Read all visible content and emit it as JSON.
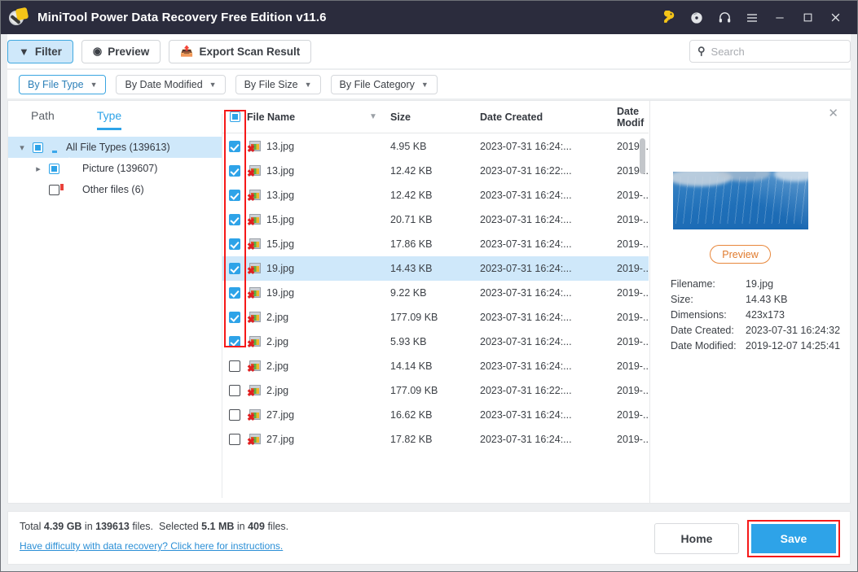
{
  "window": {
    "title": "MiniTool Power Data Recovery Free Edition v11.6",
    "icons": [
      {
        "name": "key-icon",
        "glyph": "⚷"
      },
      {
        "name": "disc-icon",
        "glyph": "●"
      },
      {
        "name": "headphones-icon",
        "glyph": "Ω"
      },
      {
        "name": "hamburger-menu-icon",
        "glyph": "≡"
      },
      {
        "name": "minimize-icon",
        "glyph": "–"
      },
      {
        "name": "maximize-icon",
        "glyph": "□"
      },
      {
        "name": "close-icon",
        "glyph": "✕"
      }
    ]
  },
  "toolbar": {
    "filter_label": "Filter",
    "preview_label": "Preview",
    "export_label": "Export Scan Result"
  },
  "search": {
    "placeholder": "Search",
    "value": ""
  },
  "chips": [
    {
      "label": "By File Type",
      "active": true
    },
    {
      "label": "By Date Modified",
      "active": false
    },
    {
      "label": "By File Size",
      "active": false
    },
    {
      "label": "By File Category",
      "active": false
    }
  ],
  "tabs": [
    {
      "label": "Path",
      "selected": false
    },
    {
      "label": "Type",
      "selected": true
    }
  ],
  "tree": [
    {
      "label": "All File Types (139613)",
      "selected": true,
      "state": "partial",
      "icon": "monitor-icon",
      "expanded": true,
      "depth": 0
    },
    {
      "label": "Picture (139607)",
      "selected": false,
      "state": "partial",
      "icon": "picture-icon",
      "expanded": false,
      "depth": 1
    },
    {
      "label": "Other files (6)",
      "selected": false,
      "state": "empty",
      "icon": "other-files-icon",
      "expanded": null,
      "depth": 1
    }
  ],
  "list": {
    "columns": [
      "File Name",
      "Size",
      "Date Created",
      "Date Modif"
    ],
    "rows": [
      {
        "checked": true,
        "name": "13.jpg",
        "size": "4.95 KB",
        "created": "2023-07-31 16:24:...",
        "modified": "2019-...",
        "selected": false
      },
      {
        "checked": true,
        "name": "13.jpg",
        "size": "12.42 KB",
        "created": "2023-07-31 16:22:...",
        "modified": "2019-...",
        "selected": false
      },
      {
        "checked": true,
        "name": "13.jpg",
        "size": "12.42 KB",
        "created": "2023-07-31 16:24:...",
        "modified": "2019-...",
        "selected": false
      },
      {
        "checked": true,
        "name": "15.jpg",
        "size": "20.71 KB",
        "created": "2023-07-31 16:24:...",
        "modified": "2019-...",
        "selected": false
      },
      {
        "checked": true,
        "name": "15.jpg",
        "size": "17.86 KB",
        "created": "2023-07-31 16:24:...",
        "modified": "2019-...",
        "selected": false
      },
      {
        "checked": true,
        "name": "19.jpg",
        "size": "14.43 KB",
        "created": "2023-07-31 16:24:...",
        "modified": "2019-...",
        "selected": true
      },
      {
        "checked": true,
        "name": "19.jpg",
        "size": "9.22 KB",
        "created": "2023-07-31 16:24:...",
        "modified": "2019-...",
        "selected": false
      },
      {
        "checked": true,
        "name": "2.jpg",
        "size": "177.09 KB",
        "created": "2023-07-31 16:24:...",
        "modified": "2019-...",
        "selected": false
      },
      {
        "checked": true,
        "name": "2.jpg",
        "size": "5.93 KB",
        "created": "2023-07-31 16:24:...",
        "modified": "2019-...",
        "selected": false
      },
      {
        "checked": false,
        "name": "2.jpg",
        "size": "14.14 KB",
        "created": "2023-07-31 16:24:...",
        "modified": "2019-...",
        "selected": false
      },
      {
        "checked": false,
        "name": "2.jpg",
        "size": "177.09 KB",
        "created": "2023-07-31 16:22:...",
        "modified": "2019-...",
        "selected": false
      },
      {
        "checked": false,
        "name": "27.jpg",
        "size": "16.62 KB",
        "created": "2023-07-31 16:24:...",
        "modified": "2019-...",
        "selected": false
      },
      {
        "checked": false,
        "name": "27.jpg",
        "size": "17.82 KB",
        "created": "2023-07-31 16:24:...",
        "modified": "2019-...",
        "selected": false
      }
    ]
  },
  "preview_panel": {
    "close_label": "✕",
    "button_label": "Preview",
    "fields": [
      {
        "label": "Filename:",
        "value": "19.jpg"
      },
      {
        "label": "Size:",
        "value": "14.43 KB"
      },
      {
        "label": "Dimensions:",
        "value": "423x173"
      },
      {
        "label": "Date Created:",
        "value": "2023-07-31 16:24:32"
      },
      {
        "label": "Date Modified:",
        "value": "2019-12-07 14:25:41"
      }
    ]
  },
  "status": {
    "total_prefix": "Total ",
    "total_size": "4.39 GB",
    "total_mid": " in ",
    "total_count": "139613",
    "total_suffix": " files.",
    "selected_prefix": "Selected ",
    "selected_size": "5.1 MB",
    "selected_mid": " in ",
    "selected_count": "409",
    "selected_suffix": " files.",
    "help_link": "Have difficulty with data recovery? Click here for instructions."
  },
  "actions": {
    "home_label": "Home",
    "save_label": "Save"
  },
  "colors": {
    "titlebar": "#2b2c3d",
    "accent": "#2ea3e8",
    "selection": "#cfe8fa",
    "highlight_box": "#f61919",
    "preview_btn": "#e07a2c",
    "link": "#2b8fd6"
  }
}
